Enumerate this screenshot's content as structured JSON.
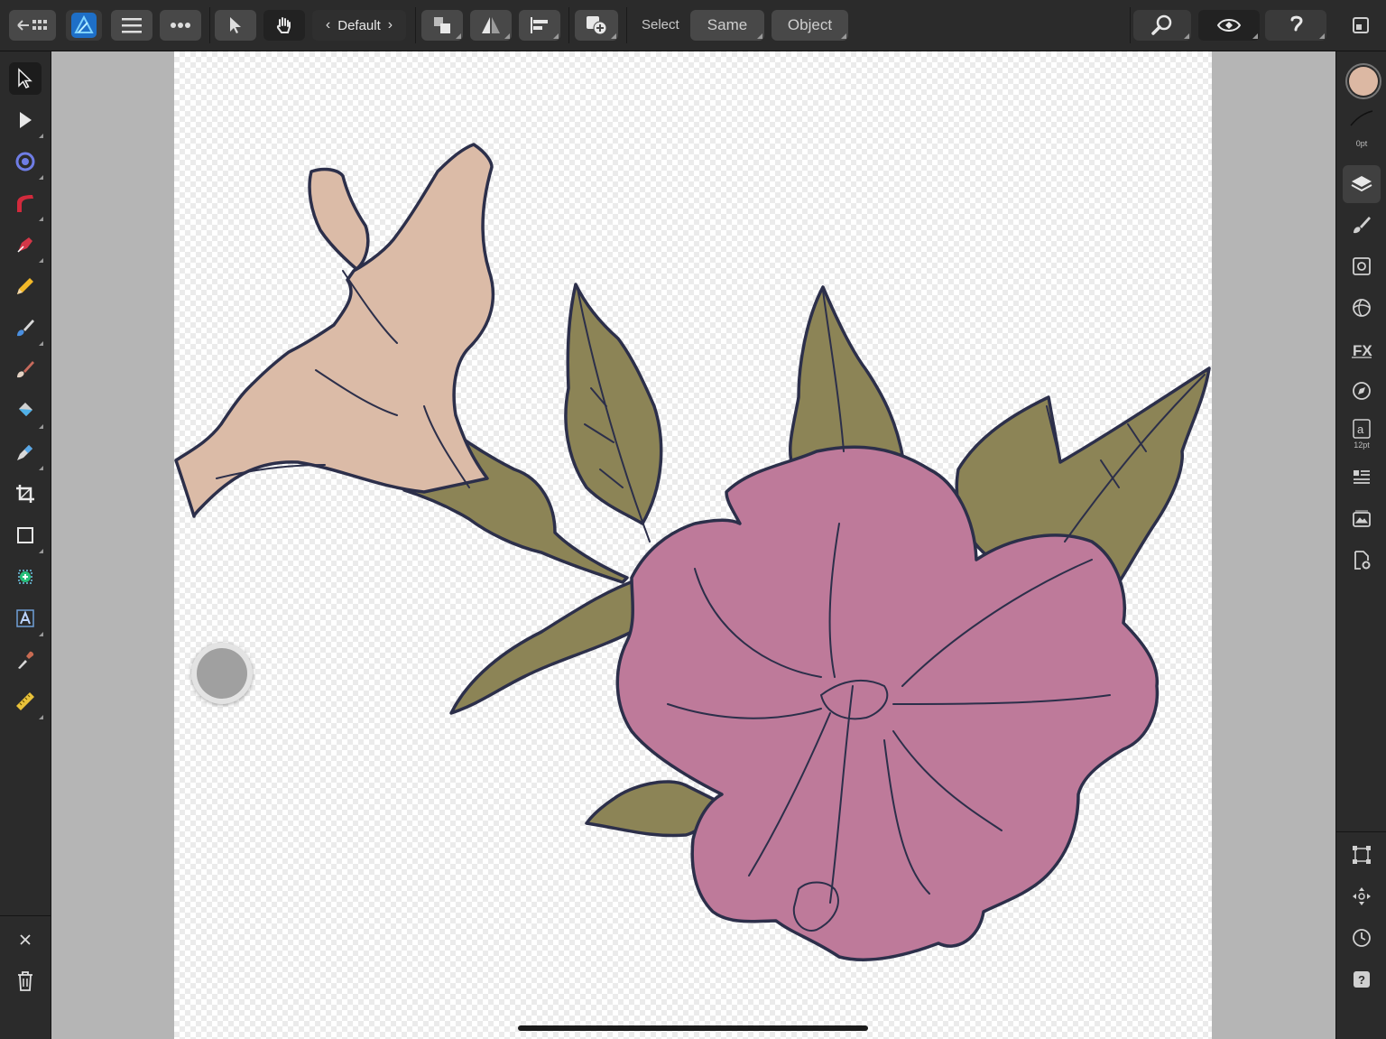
{
  "toolbar": {
    "persona_label": "Default",
    "select_label": "Select",
    "same_label": "Same",
    "object_label": "Object"
  },
  "left_tools": [
    {
      "name": "move-tool",
      "icon": "arrow-cursor-icon"
    },
    {
      "name": "node-tool",
      "icon": "node-arrow-icon"
    },
    {
      "name": "contour-tool",
      "icon": "contour-icon"
    },
    {
      "name": "corner-tool",
      "icon": "corner-icon"
    },
    {
      "name": "pen-tool",
      "icon": "pen-nib-icon"
    },
    {
      "name": "pencil-tool",
      "icon": "pencil-icon"
    },
    {
      "name": "vector-brush-tool",
      "icon": "vector-brush-icon"
    },
    {
      "name": "paint-brush-tool",
      "icon": "paint-brush-icon"
    },
    {
      "name": "fill-tool",
      "icon": "fill-bucket-icon"
    },
    {
      "name": "transparency-tool",
      "icon": "transparency-icon"
    },
    {
      "name": "crop-tool",
      "icon": "crop-icon"
    },
    {
      "name": "rectangle-tool",
      "icon": "rectangle-icon"
    },
    {
      "name": "shape-builder-tool",
      "icon": "shape-builder-icon"
    },
    {
      "name": "artistic-text-tool",
      "icon": "text-icon"
    },
    {
      "name": "color-picker-tool",
      "icon": "eyedropper-icon"
    },
    {
      "name": "measure-tool",
      "icon": "ruler-icon"
    }
  ],
  "right_panel": {
    "stroke_width_label": "0pt",
    "text_size_label": "12pt"
  },
  "colors": {
    "fill_swatch": "#dcb8a3",
    "hibiscus_pink": "#be7a9a",
    "bud_peach": "#dbbba7",
    "leaf_olive": "#8c8456",
    "outline": "#2c2f4a"
  }
}
